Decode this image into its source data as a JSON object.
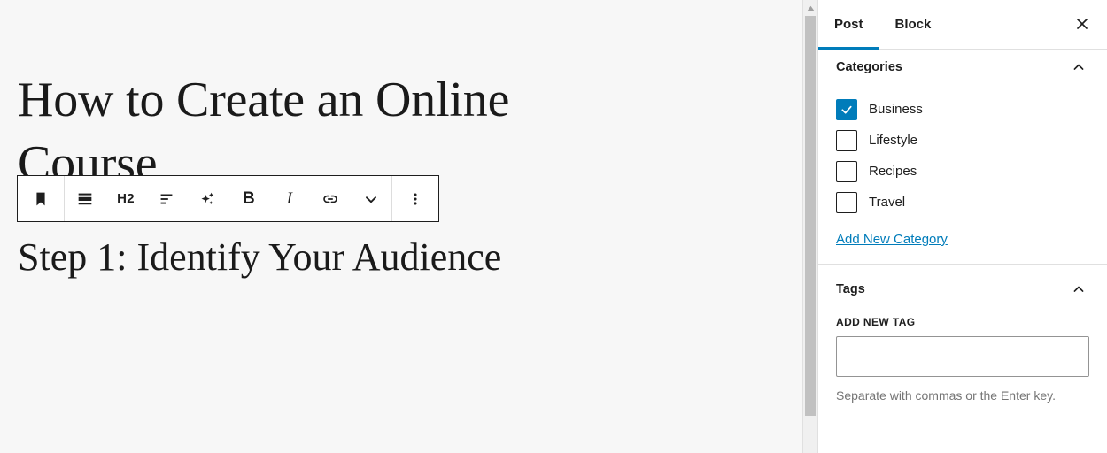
{
  "editor": {
    "post_title": "How to Create an Online Course",
    "heading_two": "Step 1: Identify Your Audience"
  },
  "toolbar": {
    "block_type_icon": "bookmark-icon",
    "heading_block_icon": "heading-block-icon",
    "heading_level_label": "H2",
    "align_icon": "align-left-icon",
    "ai_icon": "sparkles-icon",
    "bold_label": "B",
    "italic_label": "I",
    "link_icon": "link-icon",
    "more_formats_icon": "chevron-down-icon",
    "options_icon": "more-vertical-icon"
  },
  "sidebar": {
    "tabs": [
      {
        "label": "Post",
        "active": true
      },
      {
        "label": "Block",
        "active": false
      }
    ],
    "close_icon": "close-icon",
    "categories": {
      "title": "Categories",
      "chevron_icon": "chevron-up-icon",
      "items": [
        {
          "label": "Business",
          "checked": true
        },
        {
          "label": "Lifestyle",
          "checked": false
        },
        {
          "label": "Recipes",
          "checked": false
        },
        {
          "label": "Travel",
          "checked": false
        }
      ],
      "add_new_link": "Add New Category"
    },
    "tags": {
      "title": "Tags",
      "chevron_icon": "chevron-up-icon",
      "field_label": "ADD NEW TAG",
      "input_value": "",
      "help_text": "Separate with commas or the Enter key."
    }
  },
  "colors": {
    "accent": "#007cba",
    "text": "#1e1e1e",
    "muted": "#757575",
    "canvas": "#f7f7f7"
  },
  "scrollbar": {
    "up_arrow_icon": "triangle-up-icon",
    "thumb": "scroll-thumb"
  }
}
